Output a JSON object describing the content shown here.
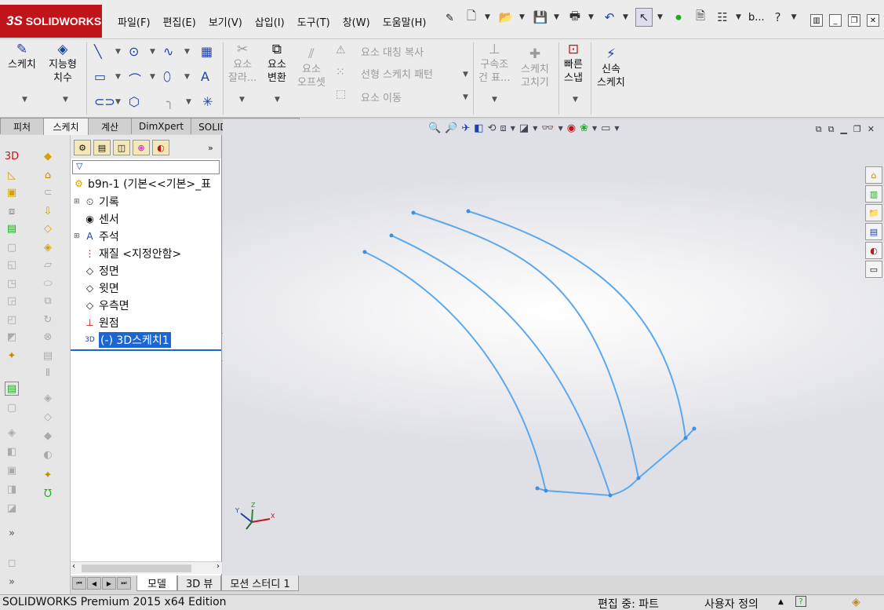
{
  "app": {
    "logo_text": "SOLIDWORKS",
    "logo_prefix": "3S"
  },
  "menu": [
    "파일(F)",
    "편집(E)",
    "보기(V)",
    "삽입(I)",
    "도구(T)",
    "창(W)",
    "도움말(H)"
  ],
  "quick_toolbar": {
    "doc_title": "b..."
  },
  "ribbon": {
    "sketch": "스케치",
    "smart_dim_1": "지능형",
    "smart_dim_2": "치수",
    "trim_1": "요소",
    "trim_2": "잘라...",
    "convert_1": "요소",
    "convert_2": "변환",
    "offset_1": "요소",
    "offset_2": "오프셋",
    "mirror": "요소 대칭 복사",
    "pattern": "선형 스케치 패턴",
    "move": "요소 이동",
    "relations_1": "구속조",
    "relations_2": "건 표...",
    "repair_1": "스케치",
    "repair_2": "고치기",
    "quick_snap_1": "빠른",
    "quick_snap_2": "스냅",
    "rapid_sketch_1": "신속",
    "rapid_sketch_2": "스케치"
  },
  "tabs": [
    "피처",
    "스케치",
    "계산",
    "DimXpert",
    "SOLIDWORKS 애드인"
  ],
  "active_tab": "스케치",
  "tree": {
    "root": "b9n-1  (기본<<기본>_표",
    "items": [
      "기록",
      "센서",
      "주석",
      "재질 <지정안함>",
      "정면",
      "윗면",
      "우측면",
      "원점",
      "(-) 3D스케치1"
    ]
  },
  "bottom_tabs": [
    "모델",
    "3D 뷰",
    "모션 스터디 1"
  ],
  "triad": {
    "x": "X",
    "y": "Y",
    "z": "Z"
  },
  "status": {
    "app": "SOLIDWORKS Premium 2015 x64 Edition",
    "mode": "편집 중: 파트",
    "units": "사용자 정의"
  },
  "colors": {
    "sketch_line": "#5aa9ee",
    "logo_bg": "#c0141b",
    "selection": "#1a66d2"
  }
}
